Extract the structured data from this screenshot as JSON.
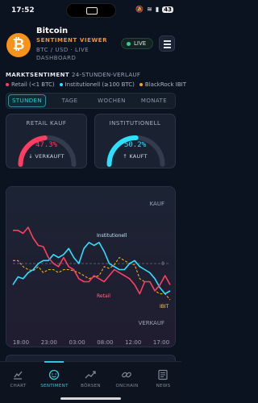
{
  "status_bar": {
    "time": "17:52",
    "battery": "43"
  },
  "header": {
    "title": "Bitcoin",
    "subtitle": "SENTIMENT VIEWER",
    "pair_line": "BTC / USD · LIVE DASHBOARD",
    "live_label": "LIVE"
  },
  "section": {
    "title": "MARKTSENTIMENT",
    "subtitle": "24-STUNDEN-VERLAUF",
    "legend": [
      {
        "label": "Retail (<1 BTC)",
        "color": "#ff3d63"
      },
      {
        "label": "Institutionell (≥100 BTC)",
        "color": "#2ee0ff"
      },
      {
        "label": "BlackRock IBIT",
        "color": "#f5a623"
      }
    ]
  },
  "tabs": [
    {
      "label": "STUNDEN",
      "active": true
    },
    {
      "label": "TAGE",
      "active": false
    },
    {
      "label": "WOCHEN",
      "active": false
    },
    {
      "label": "MONATE",
      "active": false
    }
  ],
  "gauges": [
    {
      "label": "RETAIL KAUF",
      "value": "47.3%",
      "fraction": 0.473,
      "direction": "↓ VERKAUFT",
      "color": "#ff3d63"
    },
    {
      "label": "INSTITUTIONELL",
      "value": "50.2%",
      "fraction": 0.502,
      "direction": "↑ KAUFT",
      "color": "#2ee0ff"
    }
  ],
  "chart_data": {
    "type": "line",
    "x_labels": [
      "18:00",
      "23:00",
      "03:00",
      "08:00",
      "12:00",
      "17:00"
    ],
    "y_top_label": "KAUF",
    "y_bottom_label": "VERKAUF",
    "zero_label": "0",
    "ylim": [
      -1,
      1
    ],
    "series": [
      {
        "name": "Retail",
        "color": "#ff3d63",
        "values": [
          0.55,
          0.55,
          0.5,
          0.6,
          0.42,
          0.3,
          0.28,
          0.1,
          0.0,
          -0.05,
          0.1,
          -0.05,
          -0.1,
          -0.25,
          -0.3,
          -0.3,
          -0.2,
          -0.25,
          -0.3,
          -0.2,
          -0.1,
          -0.15,
          -0.2,
          -0.25,
          -0.35,
          -0.5,
          -0.3,
          -0.3,
          -0.45,
          -0.35,
          -0.2,
          -0.35
        ]
      },
      {
        "name": "Institutionell",
        "color": "#2ee0ff",
        "values": [
          -0.35,
          -0.22,
          -0.25,
          -0.15,
          -0.1,
          0.0,
          0.05,
          0.05,
          0.15,
          0.1,
          0.15,
          0.25,
          0.1,
          0.0,
          0.25,
          0.35,
          0.3,
          0.35,
          0.2,
          0.0,
          -0.05,
          -0.1,
          -0.1,
          0.0,
          0.05,
          -0.05,
          -0.1,
          -0.15,
          -0.25,
          -0.4,
          -0.5,
          -0.45
        ]
      },
      {
        "name": "IBIT",
        "color": "#f5a623",
        "values": [
          0.05,
          0.05,
          -0.05,
          -0.1,
          -0.12,
          -0.05,
          -0.15,
          -0.1,
          -0.1,
          -0.15,
          -0.1,
          -0.1,
          -0.12,
          -0.15,
          -0.2,
          -0.25,
          -0.22,
          -0.2,
          -0.05,
          -0.08,
          -0.02,
          0.1,
          0.05,
          0.0,
          -0.02,
          -0.25,
          -0.3,
          -0.3,
          -0.45,
          -0.5,
          -0.5,
          -0.6
        ]
      }
    ]
  },
  "bottom_nav": [
    {
      "label": "CHART",
      "icon": "chart-icon",
      "active": false
    },
    {
      "label": "SENTIMENT",
      "icon": "smile-icon",
      "active": true
    },
    {
      "label": "BÖRSEN",
      "icon": "trend-icon",
      "active": false
    },
    {
      "label": "ONCHAIN",
      "icon": "link-icon",
      "active": false
    },
    {
      "label": "NEWS",
      "icon": "news-icon",
      "active": false
    }
  ]
}
